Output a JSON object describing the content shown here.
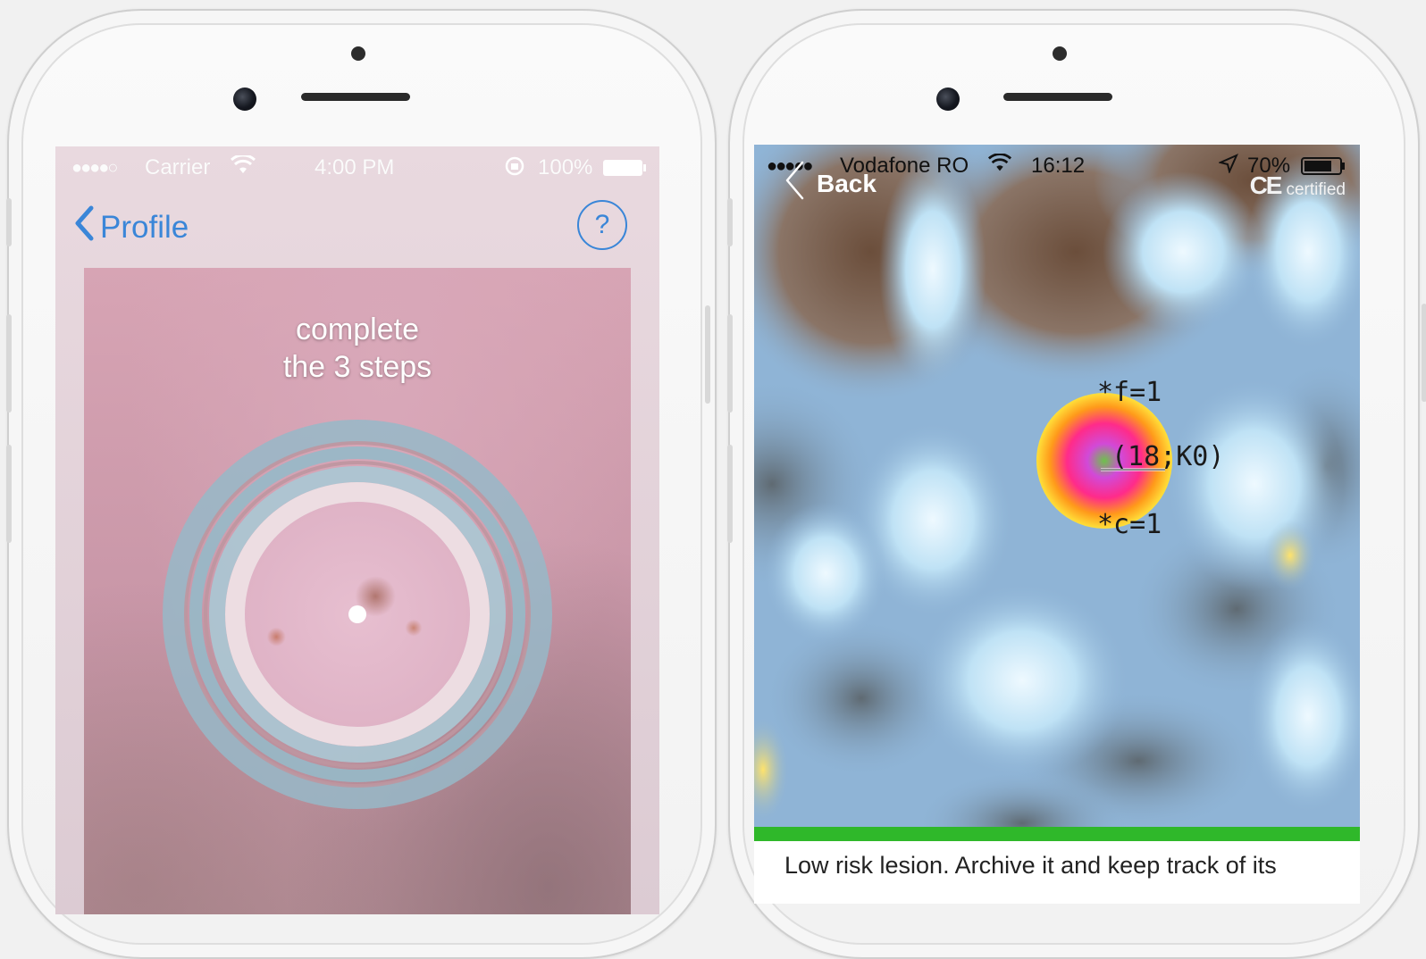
{
  "left_phone": {
    "status_bar": {
      "signal": "●●●●○",
      "carrier": "Carrier",
      "time": "4:00 PM",
      "battery": "100%"
    },
    "nav": {
      "back_label": "Profile",
      "help_label": "?"
    },
    "camera": {
      "instruction_line1": "complete",
      "instruction_line2": "the 3 steps"
    }
  },
  "right_phone": {
    "status_bar": {
      "signal": "●●●●●",
      "carrier": "Vodafone RO",
      "time": "16:12",
      "battery": "70%"
    },
    "nav": {
      "back_label": "Back"
    },
    "ce_mark": {
      "symbol": "CE",
      "text": "certified"
    },
    "annotations": {
      "f_label": "*f=1",
      "coord_label": "(18;K0)",
      "c_label": "*c=1"
    },
    "result": {
      "text": "Low risk lesion. Archive it and keep track of its",
      "risk_color": "#2fb82a"
    }
  },
  "colors": {
    "accent": "#3a86d8",
    "risk_low": "#2fb82a"
  }
}
